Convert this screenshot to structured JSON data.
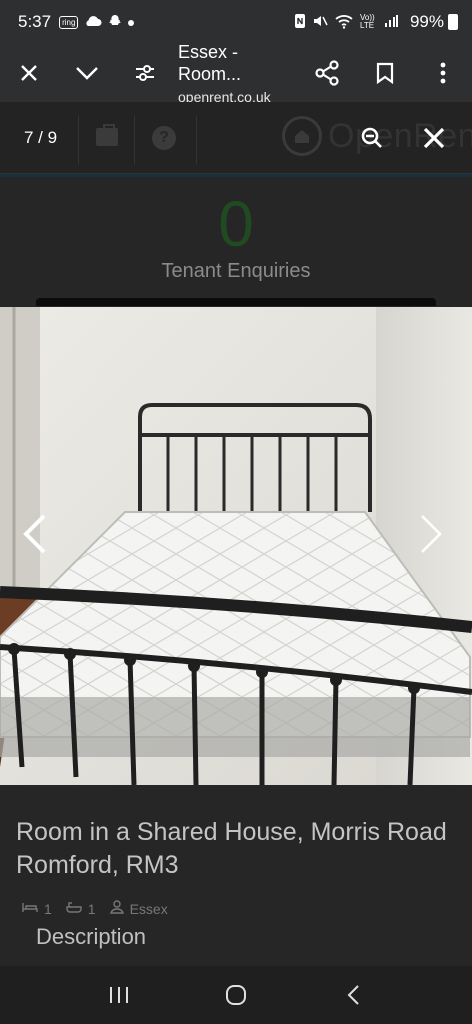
{
  "status_bar": {
    "time": "5:37",
    "ring_badge": "ring",
    "battery": "99%",
    "icons": [
      "ring-icon",
      "cloud-icon",
      "snapchat-icon",
      "dot-icon",
      "nfc-icon",
      "mute-icon",
      "wifi-icon",
      "volte-icon",
      "signal-icon",
      "battery-icon"
    ],
    "volte_label": "Vo)) LTE"
  },
  "tab_bar": {
    "title": "Essex - Room...",
    "url": "openrent.co.uk",
    "icons": [
      "close-icon",
      "chevron-down-icon",
      "page-settings-icon",
      "share-icon",
      "bookmark-icon",
      "more-vert-icon"
    ]
  },
  "site": {
    "logo_text": "OpenRent",
    "enquiries_count": "0",
    "enquiries_label": "Tenant Enquiries"
  },
  "gallery": {
    "counter": "7 / 9",
    "current": 7,
    "total": 9
  },
  "listing": {
    "title": "Room in a Shared House, Morris Road Romford, RM3",
    "bedrooms": "1",
    "bathrooms": "1",
    "location": "Essex",
    "description_heading": "Description"
  },
  "nav_bar": {
    "icons": [
      "recent-apps-icon",
      "home-icon",
      "back-icon"
    ]
  },
  "colors": {
    "chrome": "#2d2f31",
    "enquiry_green": "#1f4a22"
  }
}
